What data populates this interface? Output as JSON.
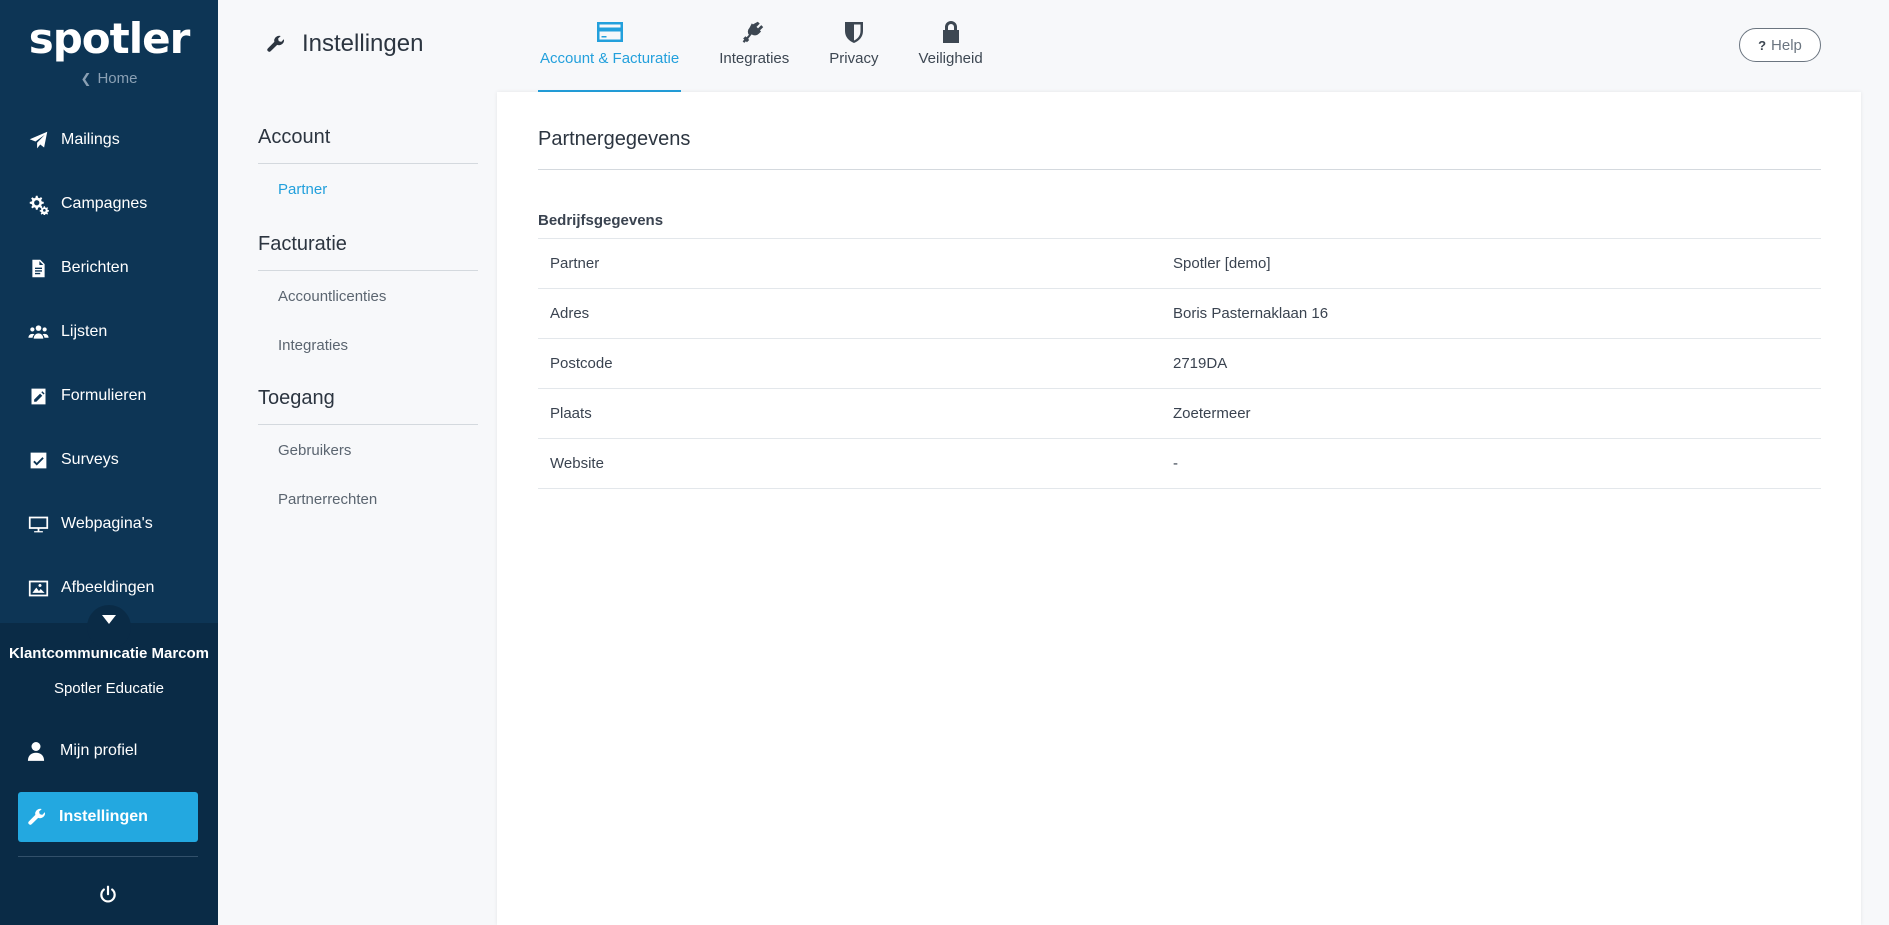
{
  "sidebar": {
    "logo": "spotler",
    "home_link": "Home",
    "items": [
      {
        "label": "Mailings",
        "icon": "paper-plane-icon"
      },
      {
        "label": "Campagnes",
        "icon": "gears-icon"
      },
      {
        "label": "Berichten",
        "icon": "document-icon"
      },
      {
        "label": "Lijsten",
        "icon": "users-icon"
      },
      {
        "label": "Formulieren",
        "icon": "edit-form-icon"
      },
      {
        "label": "Surveys",
        "icon": "checkbox-icon"
      },
      {
        "label": "Webpagina's",
        "icon": "monitor-icon"
      },
      {
        "label": "Afbeeldingen",
        "icon": "image-icon"
      }
    ],
    "account_name": "Klantcommunicatie Marcom",
    "account_sub": "Spotler Educatie",
    "profile_label": "Mijn profiel",
    "settings_label": "Instellingen"
  },
  "header": {
    "title": "Instellingen",
    "tabs": [
      {
        "label": "Account & Facturatie",
        "icon": "credit-card-icon",
        "active": true
      },
      {
        "label": "Integraties",
        "icon": "plug-icon",
        "active": false
      },
      {
        "label": "Privacy",
        "icon": "shield-icon",
        "active": false
      },
      {
        "label": "Veiligheid",
        "icon": "lock-icon",
        "active": false
      }
    ],
    "help_label": "Help"
  },
  "subnav": {
    "sections": [
      {
        "title": "Account",
        "links": [
          {
            "label": "Partner",
            "active": true
          }
        ]
      },
      {
        "title": "Facturatie",
        "links": [
          {
            "label": "Accountlicenties",
            "active": false
          },
          {
            "label": "Integraties",
            "active": false
          }
        ]
      },
      {
        "title": "Toegang",
        "links": [
          {
            "label": "Gebruikers",
            "active": false
          },
          {
            "label": "Partnerrechten",
            "active": false
          }
        ]
      }
    ]
  },
  "main": {
    "title": "Partnergegevens",
    "section_heading": "Bedrijfsgegevens",
    "rows": [
      {
        "key": "Partner",
        "value": "Spotler [demo]"
      },
      {
        "key": "Adres",
        "value": "Boris Pasternaklaan 16"
      },
      {
        "key": "Postcode",
        "value": "2719DA"
      },
      {
        "key": "Plaats",
        "value": "Zoetermeer"
      },
      {
        "key": "Website",
        "value": "-"
      }
    ]
  },
  "colors": {
    "sidebar_bg": "#0d3555",
    "accent": "#23a8e0",
    "tab_active": "#23a0dc"
  }
}
